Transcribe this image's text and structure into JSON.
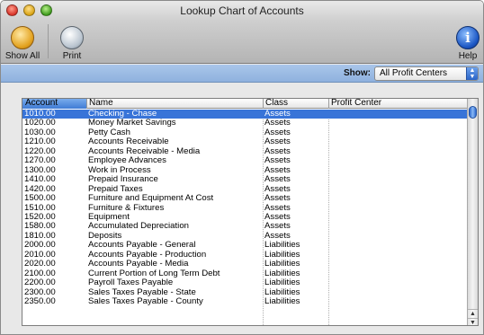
{
  "window": {
    "title": "Lookup Chart of Accounts"
  },
  "toolbar": {
    "show_all_label": "Show All",
    "print_label": "Print",
    "help_label": "Help",
    "help_glyph": "i"
  },
  "filter": {
    "show_label": "Show:",
    "selected": "All Profit Centers"
  },
  "table": {
    "headers": {
      "account": "Account",
      "name": "Name",
      "class": "Class",
      "profit_center": "Profit Center"
    },
    "rows": [
      {
        "account": "1010.00",
        "name": "Checking - Chase",
        "class": "Assets",
        "profit_center": ""
      },
      {
        "account": "1020.00",
        "name": "Money Market Savings",
        "class": "Assets",
        "profit_center": ""
      },
      {
        "account": "1030.00",
        "name": "Petty Cash",
        "class": "Assets",
        "profit_center": ""
      },
      {
        "account": "1210.00",
        "name": "Accounts Receivable",
        "class": "Assets",
        "profit_center": ""
      },
      {
        "account": "1220.00",
        "name": "Accounts Receivable - Media",
        "class": "Assets",
        "profit_center": ""
      },
      {
        "account": "1270.00",
        "name": "Employee Advances",
        "class": "Assets",
        "profit_center": ""
      },
      {
        "account": "1300.00",
        "name": "Work in Process",
        "class": "Assets",
        "profit_center": ""
      },
      {
        "account": "1410.00",
        "name": "Prepaid Insurance",
        "class": "Assets",
        "profit_center": ""
      },
      {
        "account": "1420.00",
        "name": "Prepaid Taxes",
        "class": "Assets",
        "profit_center": ""
      },
      {
        "account": "1500.00",
        "name": "Furniture and Equipment At Cost",
        "class": "Assets",
        "profit_center": ""
      },
      {
        "account": "1510.00",
        "name": "Furniture & Fixtures",
        "class": "Assets",
        "profit_center": ""
      },
      {
        "account": "1520.00",
        "name": "Equipment",
        "class": "Assets",
        "profit_center": ""
      },
      {
        "account": "1580.00",
        "name": "Accumulated Depreciation",
        "class": "Assets",
        "profit_center": ""
      },
      {
        "account": "1810.00",
        "name": "Deposits",
        "class": "Assets",
        "profit_center": ""
      },
      {
        "account": "2000.00",
        "name": "Accounts Payable - General",
        "class": "Liabilities",
        "profit_center": ""
      },
      {
        "account": "2010.00",
        "name": "Accounts Payable - Production",
        "class": "Liabilities",
        "profit_center": ""
      },
      {
        "account": "2020.00",
        "name": "Accounts Payable - Media",
        "class": "Liabilities",
        "profit_center": ""
      },
      {
        "account": "2100.00",
        "name": "Current Portion of Long Term Debt",
        "class": "Liabilities",
        "profit_center": ""
      },
      {
        "account": "2200.00",
        "name": "Payroll Taxes Payable",
        "class": "Liabilities",
        "profit_center": ""
      },
      {
        "account": "2300.00",
        "name": "Sales Taxes Payable - State",
        "class": "Liabilities",
        "profit_center": ""
      },
      {
        "account": "2350.00",
        "name": "Sales Taxes Payable - County",
        "class": "Liabilities",
        "profit_center": ""
      }
    ],
    "selected_index": 0
  },
  "colors": {
    "selection": "#3874d8",
    "filter_bar": "#9bbbe4",
    "sorted_header": "#5d95e0"
  }
}
